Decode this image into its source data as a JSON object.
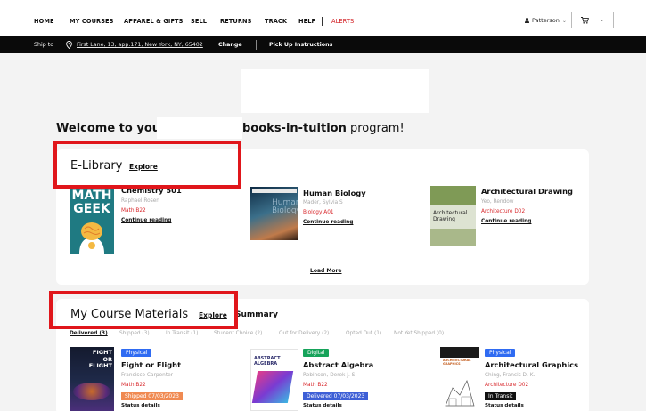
{
  "nav": {
    "items": [
      "HOME",
      "MY COURSES",
      "APPAREL & GIFTS",
      "SELL",
      "RETURNS",
      "TRACK",
      "HELP"
    ],
    "alerts": "ALERTS",
    "user": "Patterson"
  },
  "shipbar": {
    "label": "Ship to",
    "address": "First Lane, 13, app.171, New York, NY, 65402",
    "change": "Change",
    "pickup": "Pick Up Instructions"
  },
  "welcome": {
    "prefix": "Welcome to your",
    "brand": "books-in-tuition",
    "suffix": "program!"
  },
  "elibrary": {
    "title": "E-Library",
    "explore": "Explore",
    "load_more": "Load More",
    "books": [
      {
        "title": "Chemistry 501",
        "author": "Raphael Rosen",
        "course": "Math B22",
        "action": "Continue reading",
        "cover_text": [
          "MATH",
          "GEEK"
        ]
      },
      {
        "title": "Human Biology",
        "author": "Mader, Sylvia S",
        "course": "Biology A01",
        "action": "Continue reading",
        "cover_text": [
          "Human",
          "Biology"
        ]
      },
      {
        "title": "Architectural Drawing",
        "author": "Yeo, Rendow",
        "course": "Architecture D02",
        "action": "Continue reading",
        "cover_text": [
          "Architectural",
          "Drawing"
        ]
      }
    ]
  },
  "materials": {
    "title": "My Course Materials",
    "explore": "Explore",
    "summary": "Summary",
    "tabs": [
      "Delivered (3)",
      "Shipped (3)",
      "In Transit (1)",
      "Student Choice (2)",
      "Out for Delivery (2)",
      "Opted Out (1)",
      "Not Yet Shipped (0)"
    ],
    "books": [
      {
        "format": "Physical",
        "title": "Fight or Flight",
        "author": "Francisco Carpenter",
        "course": "Math B22",
        "status": "Shipped 07/03/2023",
        "details": "Status details",
        "cover_text": [
          "FIGHT",
          "OR",
          "FLIGHT"
        ]
      },
      {
        "format": "Digital",
        "title": "Abstract Algebra",
        "author": "Robinson, Derek J. S.",
        "course": "Math B22",
        "status": "Delivered 07/03/2023",
        "details": "Status details",
        "cover_text": [
          "ABSTRACT",
          "ALGEBRA"
        ]
      },
      {
        "format": "Physical",
        "title": "Architectural Graphics",
        "author": "Ching, Francis D. K.",
        "course": "Architecture D02",
        "status": "In Transit",
        "details": "Status details",
        "cover_text": [
          "ARCHITECTURAL",
          "GRAPHICS"
        ]
      }
    ]
  },
  "colors": {
    "alert": "#d0161b",
    "highlight_box": "#e0161b",
    "physical": "#2f6bf2",
    "digital": "#16a35a",
    "shipped": "#f08a52",
    "delivered": "#3d5fd6",
    "in_transit": "#111111",
    "course": "#d8282c"
  }
}
